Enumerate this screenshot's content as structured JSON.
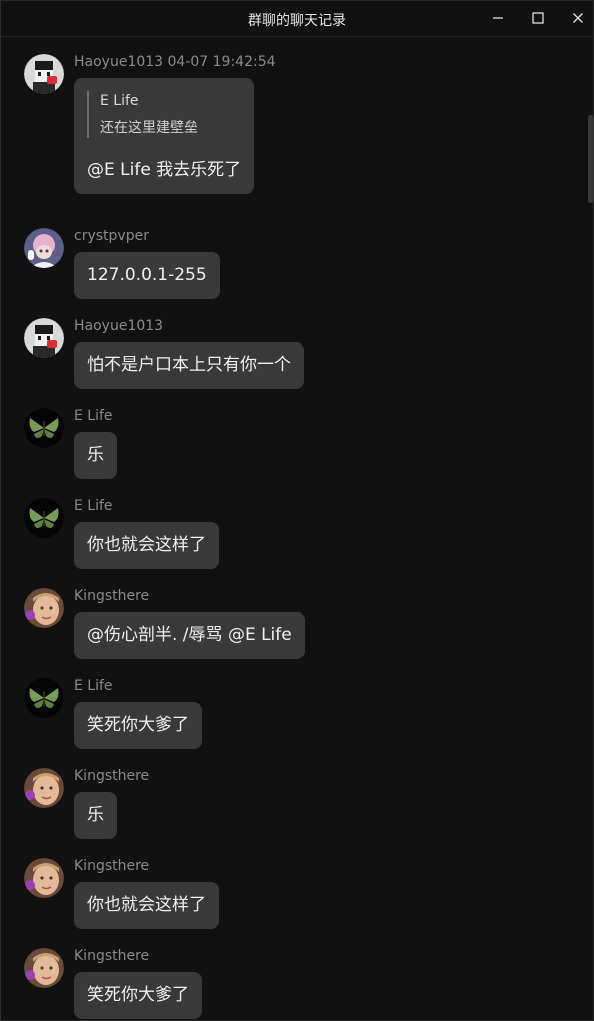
{
  "window": {
    "title": "群聊的聊天记录",
    "controls": {
      "minimize": "minimize-icon",
      "maximize": "maximize-icon",
      "close": "close-icon"
    }
  },
  "messages": [
    {
      "sender": "Haoyue1013 04-07 19:42:54",
      "avatar": "pixel-character-avatar",
      "quote": {
        "author": "E Life",
        "text": "还在这里建壁垒"
      },
      "text": "@E Life 我去乐死了"
    },
    {
      "sender": "crystpvper",
      "avatar": "anime-girl-avatar",
      "text": "127.0.0.1-255"
    },
    {
      "sender": "Haoyue1013",
      "avatar": "pixel-character-avatar",
      "text": "怕不是户口本上只有你一个"
    },
    {
      "sender": "E Life",
      "avatar": "green-butterfly-avatar",
      "text": "乐"
    },
    {
      "sender": "E Life",
      "avatar": "green-butterfly-avatar",
      "text": "你也就会这样了"
    },
    {
      "sender": "Kingsthere",
      "avatar": "face-photo-avatar",
      "text": "@伤心剖半. /辱骂 @E Life"
    },
    {
      "sender": "E Life",
      "avatar": "green-butterfly-avatar",
      "text": "笑死你大爹了"
    },
    {
      "sender": "Kingsthere",
      "avatar": "face-photo-avatar",
      "text": "乐"
    },
    {
      "sender": "Kingsthere",
      "avatar": "face-photo-avatar",
      "text": "你也就会这样了"
    },
    {
      "sender": "Kingsthere",
      "avatar": "face-photo-avatar",
      "text": "笑死你大爹了"
    }
  ],
  "colors": {
    "background": "#111111",
    "bubble": "#393939",
    "sender_text": "#8a8a8a",
    "message_text": "#f0f0f0"
  }
}
